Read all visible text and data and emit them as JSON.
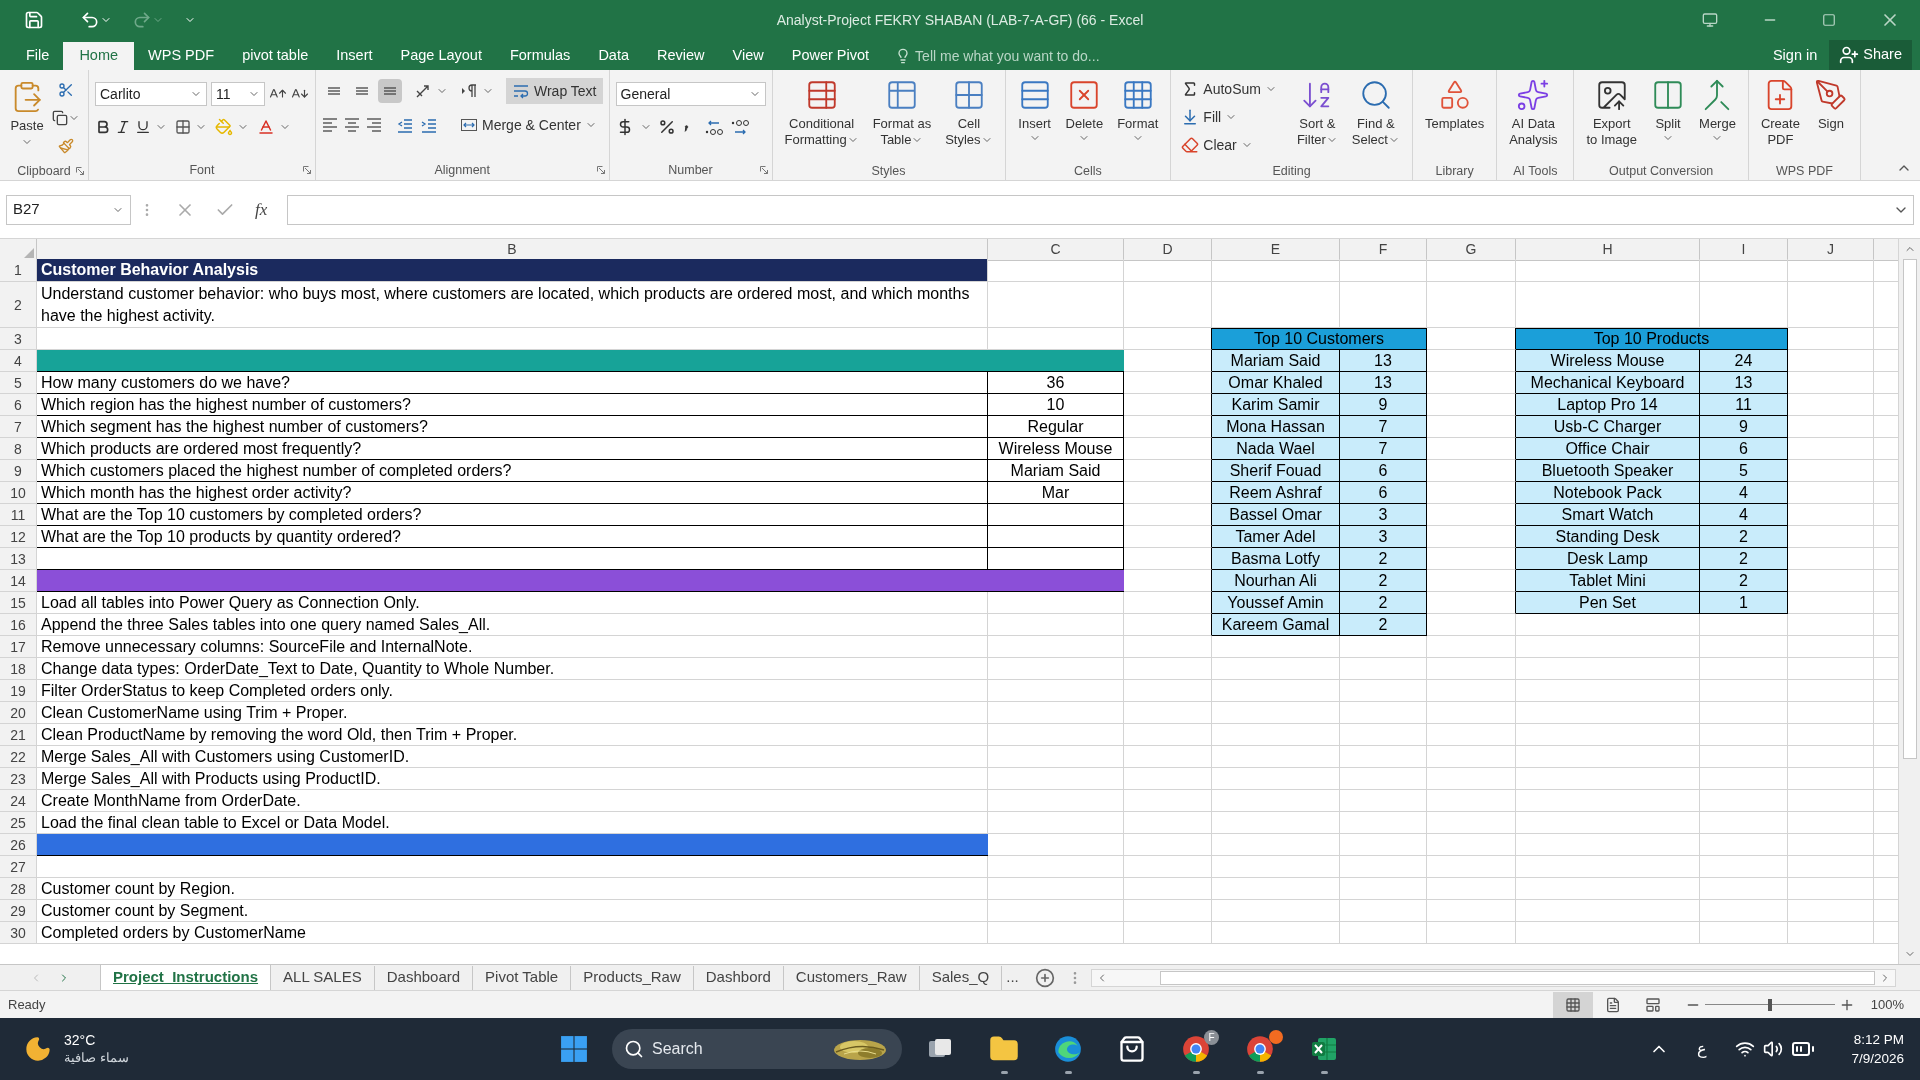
{
  "window": {
    "title": "Analyst-Project FEKRY SHABAN (LAB-7-A-GF) (66 - Excel"
  },
  "menu": {
    "tabs": [
      {
        "label": "File",
        "selected": false
      },
      {
        "label": "Home",
        "selected": true
      },
      {
        "label": "WPS PDF",
        "selected": false
      },
      {
        "label": "pivot table",
        "selected": false
      },
      {
        "label": "Insert",
        "selected": false
      },
      {
        "label": "Page Layout",
        "selected": false
      },
      {
        "label": "Formulas",
        "selected": false
      },
      {
        "label": "Data",
        "selected": false
      },
      {
        "label": "Review",
        "selected": false
      },
      {
        "label": "View",
        "selected": false
      },
      {
        "label": "Power Pivot",
        "selected": false
      }
    ],
    "tell_me": {
      "placeholder": "Tell me what you want to do..."
    },
    "sign_in": "Sign in",
    "share": "Share"
  },
  "ribbon": {
    "groups": [
      {
        "kind": "clipboard",
        "label": "Clipboard",
        "launcher": true,
        "paste": "Paste"
      },
      {
        "kind": "font",
        "label": "Font",
        "launcher": true,
        "font_name": "Carlito",
        "font_size": "11"
      },
      {
        "kind": "alignment",
        "label": "Alignment",
        "launcher": true,
        "vertical_align": [
          {
            "on": false
          },
          {
            "on": false
          },
          {
            "on": true
          }
        ],
        "wrap_text": {
          "label": "Wrap Text",
          "on": true
        },
        "merge": "Merge & Center"
      },
      {
        "kind": "number",
        "label": "Number",
        "launcher": true,
        "format": "General"
      },
      {
        "kind": "buttons",
        "label": "Styles",
        "launcher": false,
        "buttons": [
          {
            "kind": "conditional-formatting",
            "lines": [
              "Conditional",
              "Formatting"
            ],
            "dropdown": true
          },
          {
            "kind": "format-as-table",
            "lines": [
              "Format as",
              "Table"
            ],
            "dropdown": true
          },
          {
            "kind": "cell-styles",
            "lines": [
              "Cell",
              "Styles"
            ],
            "dropdown": true
          }
        ]
      },
      {
        "kind": "buttons",
        "label": "Cells",
        "launcher": false,
        "buttons": [
          {
            "kind": "insert",
            "lines": [
              "Insert"
            ],
            "dropdown": true
          },
          {
            "kind": "delete",
            "lines": [
              "Delete"
            ],
            "dropdown": true
          },
          {
            "kind": "format",
            "lines": [
              "Format"
            ],
            "dropdown": true
          }
        ]
      },
      {
        "kind": "editing",
        "label": "Editing",
        "launcher": false,
        "small": [
          {
            "kind": "autosum",
            "label": "AutoSum"
          },
          {
            "kind": "fill",
            "label": "Fill"
          },
          {
            "kind": "clear",
            "label": "Clear"
          }
        ],
        "buttons": [
          {
            "kind": "sort-filter",
            "lines": [
              "Sort &",
              "Filter"
            ],
            "dropdown": true
          },
          {
            "kind": "find-select",
            "lines": [
              "Find &",
              "Select"
            ],
            "dropdown": true
          }
        ]
      },
      {
        "kind": "buttons",
        "label": "Library",
        "launcher": false,
        "buttons": [
          {
            "kind": "templates",
            "lines": [
              "Templates"
            ],
            "dropdown": false
          }
        ]
      },
      {
        "kind": "buttons",
        "label": "AI Tools",
        "launcher": false,
        "buttons": [
          {
            "kind": "ai-analysis",
            "lines": [
              "AI Data",
              "Analysis"
            ],
            "dropdown": false
          }
        ]
      },
      {
        "kind": "buttons",
        "label": "Output Conversion",
        "launcher": false,
        "buttons": [
          {
            "kind": "export-image",
            "lines": [
              "Export",
              "to Image"
            ],
            "dropdown": false
          },
          {
            "kind": "split",
            "lines": [
              "Split"
            ],
            "dropdown": true
          },
          {
            "kind": "merge",
            "lines": [
              "Merge"
            ],
            "dropdown": true
          }
        ]
      },
      {
        "kind": "buttons",
        "label": "WPS PDF",
        "launcher": false,
        "buttons": [
          {
            "kind": "create-pdf",
            "lines": [
              "Create",
              "PDF"
            ],
            "dropdown": false
          },
          {
            "kind": "sign",
            "lines": [
              "Sign"
            ],
            "dropdown": false
          }
        ]
      }
    ]
  },
  "formula_bar": {
    "name_box": "B27",
    "function_label": "fx"
  },
  "sheet": {
    "columns": [
      "B",
      "C",
      "D",
      "E",
      "F",
      "G",
      "H",
      "I",
      "J"
    ],
    "row_numbers": [
      "1",
      "2",
      "3",
      "4",
      "5",
      "6",
      "7",
      "8",
      "9",
      "10",
      "11",
      "12",
      "13",
      "14",
      "15",
      "16",
      "17",
      "18",
      "19",
      "20",
      "21",
      "22",
      "23",
      "24",
      "25",
      "26",
      "27",
      "28",
      "29",
      "30"
    ],
    "title": "Customer Behavior Analysis",
    "description": "Understand customer behavior: who buys most, where customers are located, which products are ordered most, and which months have the highest activity.",
    "bands": [
      {
        "color": "#17a398"
      },
      {
        "color": "#8b4fd8"
      },
      {
        "color": "#2f6fe0"
      }
    ],
    "questions": [
      {
        "question": "How many customers do we have?",
        "answer": "36"
      },
      {
        "question": "Which region has the highest number of customers?",
        "answer": "10"
      },
      {
        "question": "Which segment has the highest number of customers?",
        "answer": "Regular"
      },
      {
        "question": "Which products are ordered most frequently?",
        "answer": "Wireless Mouse"
      },
      {
        "question": "Which customers placed the highest number of completed orders?",
        "answer": "Mariam Said"
      },
      {
        "question": "Which month has the highest order activity?",
        "answer": "Mar"
      },
      {
        "question": "What are the Top 10 customers by completed orders?"
      },
      {
        "question": "What are the Top 10 products by quantity ordered?"
      }
    ],
    "steps": [
      "Load all tables into Power Query as Connection Only.",
      "Append the three Sales tables into one query named Sales_All.",
      "Remove unnecessary columns: SourceFile and InternalNote.",
      "Change data types: OrderDate_Text to Date, Quantity to Whole Number.",
      "Filter OrderStatus to keep Completed orders only.",
      "Clean CustomerName using Trim + Proper.",
      "Clean ProductName by removing the word Old, then Trim + Proper.",
      "Merge Sales_All with Customers using CustomerID.",
      "Merge Sales_All with Products using ProductID.",
      "Create MonthName from OrderDate.",
      "Load the final clean table to Excel or Data Model."
    ],
    "outputs": [
      "Customer count by Region.",
      "Customer count by Segment.",
      "Completed orders by CustomerName"
    ],
    "top_customers": {
      "title": "Top 10 Customers",
      "rows": [
        {
          "name": "Mariam Said",
          "count": "13"
        },
        {
          "name": "Omar Khaled",
          "count": "13"
        },
        {
          "name": "Karim Samir",
          "count": "9"
        },
        {
          "name": "Mona Hassan",
          "count": "7"
        },
        {
          "name": "Nada Wael",
          "count": "7"
        },
        {
          "name": "Sherif Fouad",
          "count": "6"
        },
        {
          "name": "Reem Ashraf",
          "count": "6"
        },
        {
          "name": "Bassel Omar",
          "count": "3"
        },
        {
          "name": "Tamer Adel",
          "count": "3"
        },
        {
          "name": "Basma Lotfy",
          "count": "2"
        },
        {
          "name": "Nourhan Ali",
          "count": "2"
        },
        {
          "name": "Youssef Amin",
          "count": "2"
        },
        {
          "name": "Kareem Gamal",
          "count": "2"
        }
      ]
    },
    "top_products": {
      "title": "Top 10 Products",
      "rows": [
        {
          "name": "Wireless Mouse",
          "count": "24"
        },
        {
          "name": "Mechanical Keyboard",
          "count": "13"
        },
        {
          "name": "Laptop Pro 14",
          "count": "11"
        },
        {
          "name": "Usb-C Charger",
          "count": "9"
        },
        {
          "name": "Office Chair",
          "count": "6"
        },
        {
          "name": "Bluetooth Speaker",
          "count": "5"
        },
        {
          "name": "Notebook Pack",
          "count": "4"
        },
        {
          "name": "Smart Watch",
          "count": "4"
        },
        {
          "name": "Standing Desk",
          "count": "2"
        },
        {
          "name": "Desk Lamp",
          "count": "2"
        },
        {
          "name": "Tablet Mini",
          "count": "2"
        },
        {
          "name": "Pen Set",
          "count": "1"
        }
      ]
    }
  },
  "sheet_tabs": {
    "tabs": [
      {
        "label": "Project_Instructions",
        "selected": true
      },
      {
        "label": "ALL SALES",
        "selected": false
      },
      {
        "label": "Dashboard",
        "selected": false
      },
      {
        "label": "Pivot Table",
        "selected": false
      },
      {
        "label": "Products_Raw",
        "selected": false
      },
      {
        "label": "Dashbord",
        "selected": false
      },
      {
        "label": "Customers_Raw",
        "selected": false
      },
      {
        "label": "Sales_Q",
        "selected": false
      }
    ],
    "more": "..."
  },
  "status_bar": {
    "text": "Ready",
    "views": [
      {
        "selected": true
      },
      {
        "selected": false
      },
      {
        "selected": false
      }
    ],
    "zoom": {
      "level": 0.5,
      "reading": "100%"
    }
  },
  "taskbar": {
    "weather": {
      "temperature": "32°C",
      "condition": "سماء صافية"
    },
    "search": {
      "placeholder": "Search"
    },
    "apps": [
      {
        "kind": "task-view",
        "running": false
      },
      {
        "kind": "explorer",
        "running": true
      },
      {
        "kind": "edge",
        "running": true
      },
      {
        "kind": "store",
        "running": false
      },
      {
        "kind": "chrome",
        "running": true,
        "badge": "F"
      },
      {
        "kind": "chrome-alert",
        "running": true
      },
      {
        "kind": "excel",
        "running": true
      }
    ],
    "tray": {
      "language": "ع",
      "time": "8:12 PM",
      "date": "7/9/2026"
    }
  }
}
